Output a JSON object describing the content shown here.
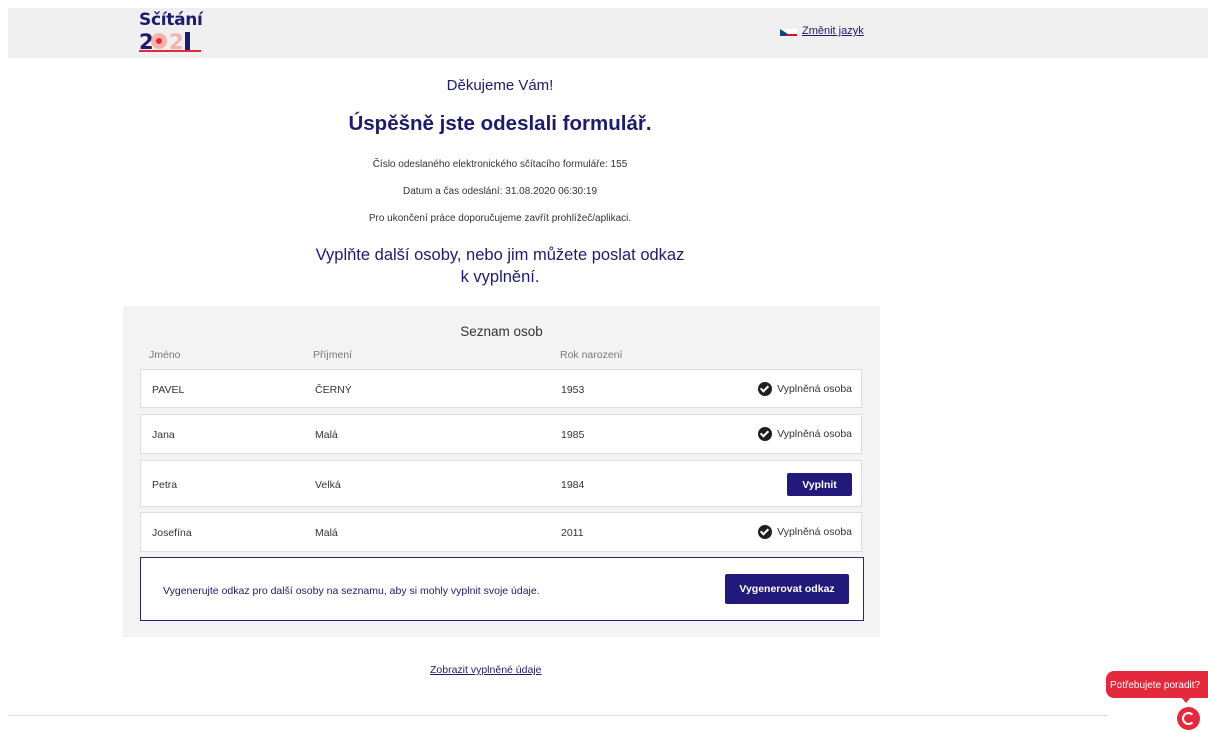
{
  "header": {
    "logo_text": "Sčítání",
    "logo_year": "2021",
    "change_language": "Změnit jazyk"
  },
  "confirmation": {
    "thanks": "Děkujeme Vám!",
    "headline": "Úspěšně jste odeslali formulář.",
    "form_number": "Číslo odeslaného elektronického sčítacího formuláře: 155",
    "sent_datetime": "Datum a čas odeslání: 31.08.2020 06:30:19",
    "close_hint": "Pro ukončení práce doporučujeme zavřít prohlížeč/aplikaci.",
    "subhead_line1": "Vyplňte další osoby, nebo jim můžete poslat odkaz",
    "subhead_line2": "k vyplnění."
  },
  "persons": {
    "title": "Seznam osob",
    "columns": [
      "Jméno",
      "Příjmení",
      "Rok narození"
    ],
    "rows": [
      {
        "first_name": "PAVEL",
        "last_name": "ČERNÝ",
        "year": "1953",
        "status": "Vyplněná osoba"
      },
      {
        "first_name": "Jana",
        "last_name": "Malá",
        "year": "1985",
        "status": "Vyplněná osoba"
      },
      {
        "first_name": "Petra",
        "last_name": "Velká",
        "year": "1984",
        "action": "Vyplnit"
      },
      {
        "first_name": "Josefína",
        "last_name": "Malá",
        "year": "2011",
        "status": "Vyplněná osoba"
      }
    ]
  },
  "generate": {
    "text": "Vygenerujte odkaz pro další osoby na seznamu, aby si mohly vyplnit svoje údaje.",
    "button": "Vygenerovat odkaz"
  },
  "show_data_link": "Zobrazit vyplněné údaje",
  "help": {
    "label": "Potřebujete poradit?",
    "icon": "chat-help-icon"
  },
  "colors": {
    "brand_navy": "#211a7a",
    "brand_red": "#e5293c",
    "header_bg": "#efefef",
    "panel_bg": "#f3f3f3"
  }
}
